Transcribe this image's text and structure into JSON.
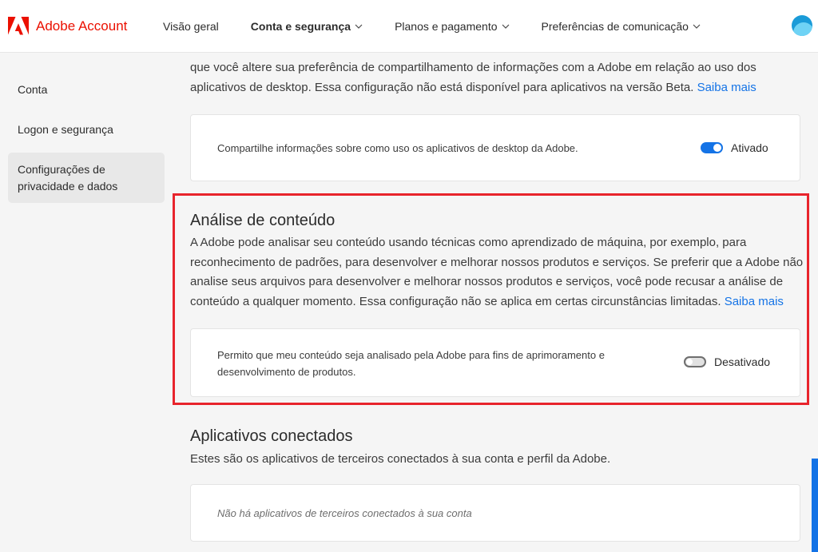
{
  "header": {
    "brand": "Adobe Account",
    "nav": [
      {
        "label": "Visão geral",
        "dropdown": false,
        "active": false
      },
      {
        "label": "Conta e segurança",
        "dropdown": true,
        "active": true
      },
      {
        "label": "Planos e pagamento",
        "dropdown": true,
        "active": false
      },
      {
        "label": "Preferências de comunicação",
        "dropdown": true,
        "active": false
      }
    ]
  },
  "sidebar": {
    "items": [
      {
        "label": "Conta"
      },
      {
        "label": "Logon e segurança"
      },
      {
        "label": "Configurações de privacidade e dados",
        "active": true
      }
    ]
  },
  "desktop_sharing": {
    "paragraph_line1": "que você altere sua preferência de compartilhamento de informações com a Adobe em relação ao uso dos",
    "paragraph_line2": "aplicativos de desktop. Essa configuração não está disponível para aplicativos na versão Beta.",
    "learn_more": "Saiba mais",
    "card_text": "Compartilhe informações sobre como uso os aplicativos de desktop da Adobe.",
    "toggle_label": "Ativado",
    "toggle_on": true
  },
  "content_analysis": {
    "title": "Análise de conteúdo",
    "paragraph": "A Adobe pode analisar seu conteúdo usando técnicas como aprendizado de máquina, por exemplo, para reconhecimento de padrões, para desenvolver e melhorar nossos produtos e serviços. Se preferir que a Adobe não analise seus arquivos para desenvolver e melhorar nossos produtos e serviços, você pode recusar a análise de conteúdo a qualquer momento. Essa configuração não se aplica em certas circunstâncias limitadas.",
    "learn_more": "Saiba mais",
    "card_text": "Permito que meu conteúdo seja analisado pela Adobe para fins de aprimoramento e desenvolvimento de produtos.",
    "toggle_label": "Desativado",
    "toggle_on": false
  },
  "connected_apps": {
    "title": "Aplicativos conectados",
    "description": "Estes são os aplicativos de terceiros conectados à sua conta e perfil da Adobe.",
    "empty_text": "Não há aplicativos de terceiros conectados à sua conta"
  },
  "colors": {
    "brand_red": "#eb1000",
    "link_blue": "#1473e6",
    "highlight_red": "#e8242c"
  }
}
